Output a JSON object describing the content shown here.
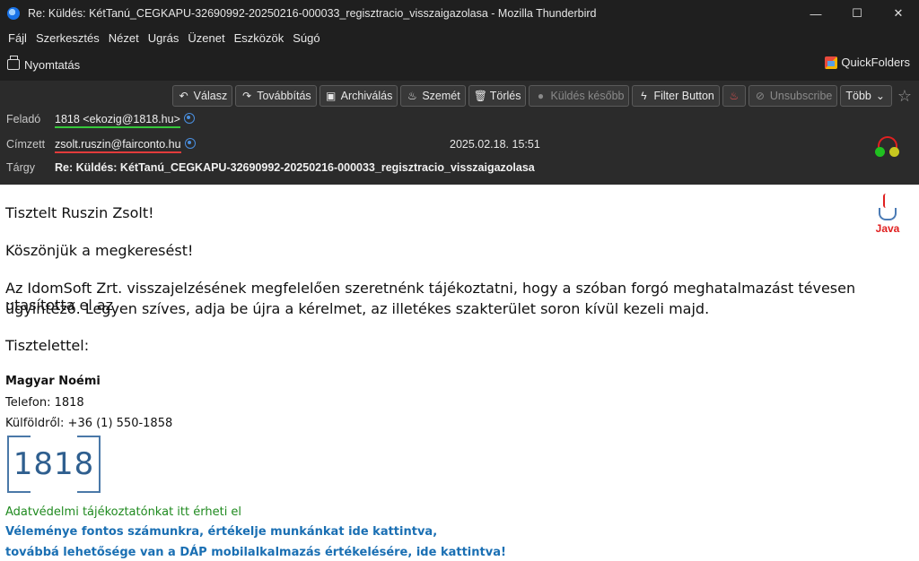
{
  "window": {
    "title": "Re: Küldés: KétTanú_CEGKAPU-32690992-20250216-000033_regisztracio_visszaigazolasa - Mozilla Thunderbird",
    "minimize": "—",
    "maximize": "☐",
    "close": "✕"
  },
  "menubar": {
    "items": [
      "Fájl",
      "Szerkesztés",
      "Nézet",
      "Ugrás",
      "Üzenet",
      "Eszközök",
      "Súgó"
    ]
  },
  "printbar": {
    "print_label": "Nyomtatás",
    "quickfolders_label": "QuickFolders"
  },
  "actions": {
    "reply": "Válasz",
    "forward": "Továbbítás",
    "archive": "Archiválás",
    "junk": "Szemét",
    "delete": "Törlés",
    "send_later": "Küldés később",
    "filter": "Filter Button",
    "unsubscribe": "Unsubscribe",
    "more": "Több"
  },
  "header": {
    "from_label": "Feladó",
    "from_value": "1818 <ekozig@1818.hu>",
    "to_label": "Címzett",
    "to_value": "zsolt.ruszin@fairconto.hu",
    "date": "2025.02.18. 15:51",
    "subject_label": "Tárgy",
    "subject_value": "Re: Küldés: KétTanú_CEGKAPU-32690992-20250216-000033_regisztracio_visszaigazolasa"
  },
  "body": {
    "greeting": "Tisztelt Ruszin Zsolt!",
    "thanks": "Köszönjük a megkeresést!",
    "para_line1": "Az IdomSoft Zrt. visszajelzésének megfelelően szeretnénk tájékoztatni, hogy a szóban forgó meghatalmazást tévesen utasította el az",
    "para_line2": "ügyintéző. Legyen szíves, adja be újra a kérelmet, az illetékes szakterület soron kívül kezeli majd.",
    "closing": "Tisztelettel:",
    "sig_name": "Magyar Noémi",
    "sig_phone": "Telefon: 1818",
    "sig_abroad": "Külföldről: +36 (1) 550-1858",
    "logo_text": "1818",
    "privacy_link": "Adatvédelmi tájékoztatónkat itt érheti el",
    "feedback_line1": "Véleménye fontos számunkra, értékelje munkánkat ide kattintva,",
    "feedback_line2": "továbbá lehetősége van a DÁP mobilalkalmazás értékelésére, ide kattintva!",
    "java_label": "Java"
  }
}
